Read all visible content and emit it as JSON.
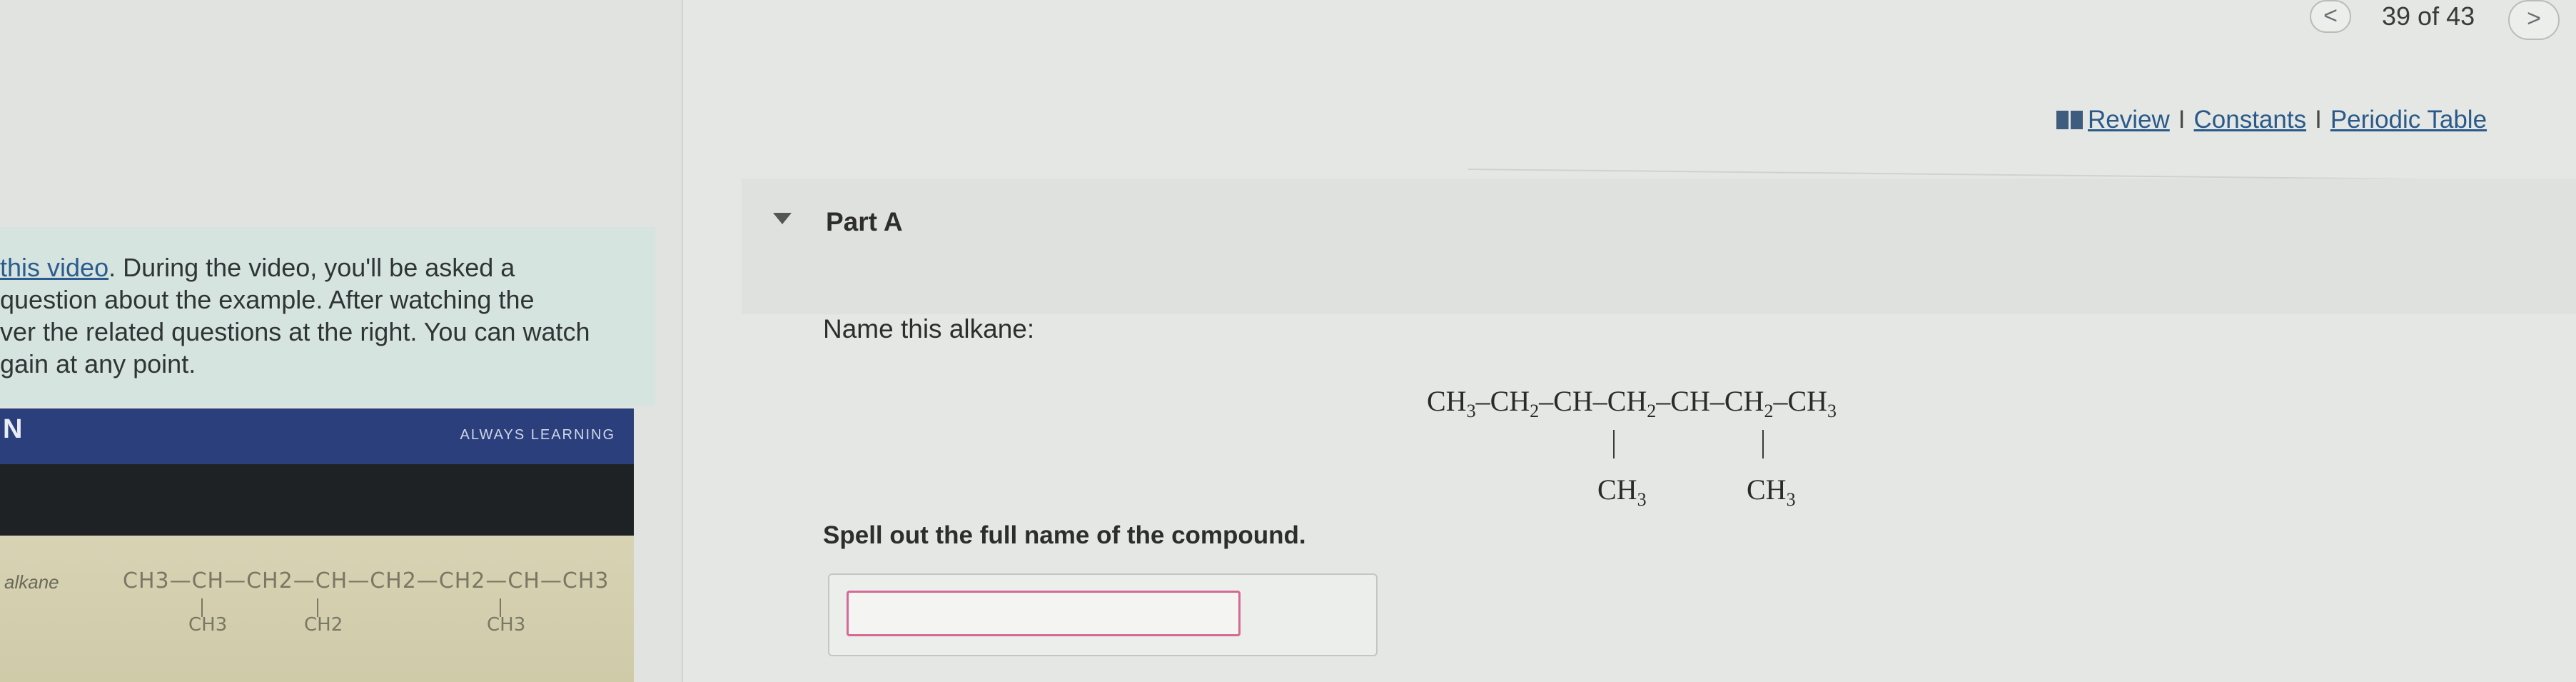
{
  "left_panel": {
    "intro_link": "this video",
    "intro_lines": [
      ". During the video, you'll be asked a",
      "question about the example. After watching the",
      "ver the related questions at the right. You can watch",
      "gain at any point."
    ],
    "video": {
      "logo": "N",
      "tagline": "ALWAYS LEARNING",
      "label": "alkane",
      "formula": "CH3—CH—CH2—CH—CH2—CH2—CH—CH3",
      "branches": [
        "CH3",
        "CH2",
        "CH3"
      ]
    }
  },
  "pagination": {
    "prev_icon": "chevron-left-icon",
    "prev_glyph": "<",
    "counter": "39 of 43",
    "next_icon": "chevron-right-icon",
    "next_glyph": ">"
  },
  "resources": {
    "icon": "book-icon",
    "review": "Review",
    "constants": "Constants",
    "periodic_table": "Periodic Table",
    "separator": "I"
  },
  "part": {
    "title": "Part A",
    "toggle_icon": "triangle-down-icon",
    "prompt": "Name this alkane:",
    "molecule": {
      "main_chain": [
        "CH",
        "3",
        "–CH",
        "2",
        "–CH–CH",
        "2",
        "–CH–CH",
        "2",
        "–CH",
        "3"
      ],
      "branch_1": [
        "CH",
        "3"
      ],
      "branch_2": [
        "CH",
        "3"
      ]
    },
    "instruction": "Spell out the full name of the compound.",
    "answer_value": ""
  },
  "colors": {
    "link": "#2a5a8a",
    "video_bar": "#2b3f7c",
    "input_border": "#d46a95",
    "intro_box": "#d6e4df"
  }
}
